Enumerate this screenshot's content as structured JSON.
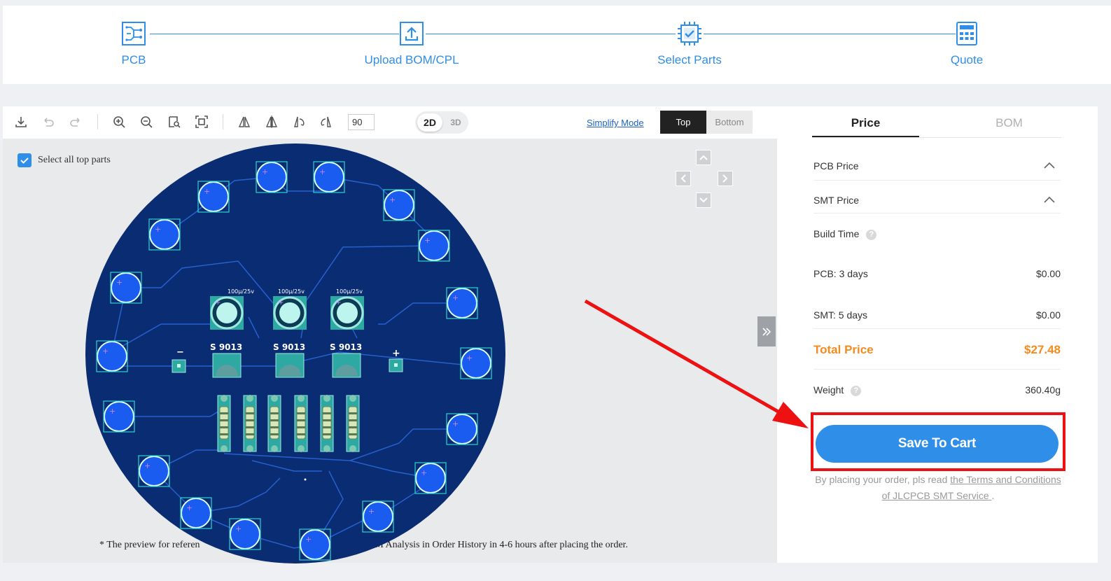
{
  "steps": [
    {
      "label": "PCB",
      "icon": "circuit-board-icon"
    },
    {
      "label": "Upload BOM/CPL",
      "icon": "upload-icon"
    },
    {
      "label": "Select Parts",
      "icon": "chip-icon"
    },
    {
      "label": "Quote",
      "icon": "calculator-icon"
    }
  ],
  "toolbar": {
    "rotation_value": "90",
    "dim_2d": "2D",
    "dim_3d": "3D",
    "simplify_mode": "Simplify Mode",
    "side_top": "Top",
    "side_bottom": "Bottom"
  },
  "viewer": {
    "select_all_label": "Select all top parts",
    "preview_note_start": "* The preview for referen",
    "preview_note_end": "PM Analysis in Order History in 4-6 hours after placing the order.",
    "pcb": {
      "cap_label": "100μ/25v",
      "transistor_label": "S 9013",
      "minus_label": "−",
      "plus_label": "+"
    }
  },
  "panel": {
    "tab_price": "Price",
    "tab_bom": "BOM",
    "pcb_price_label": "PCB Price",
    "smt_price_label": "SMT Price",
    "build_time_label": "Build Time",
    "pcb_days_label": "PCB: 3 days",
    "pcb_days_value": "$0.00",
    "smt_days_label": "SMT: 5 days",
    "smt_days_value": "$0.00",
    "total_label": "Total Price",
    "total_value": "$27.48",
    "weight_label": "Weight",
    "weight_value": "360.40g",
    "save_button": "Save To Cart",
    "terms_prefix": "By placing your order, pls read ",
    "terms_link": "the Terms and Conditions of JLCPCB SMT Service ",
    "terms_suffix": "."
  },
  "colors": {
    "accent": "#2f8ee8",
    "total": "#f58a1f",
    "highlight": "#ee1111",
    "pcb_board": "#0a2c72"
  }
}
